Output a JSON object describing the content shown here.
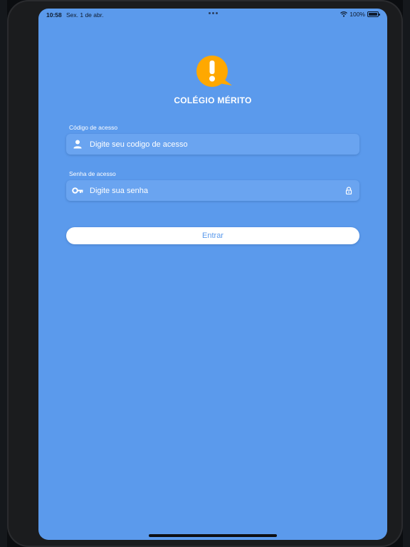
{
  "status_bar": {
    "time": "10:58",
    "date": "Sex. 1 de abr.",
    "battery_level": "100%"
  },
  "brand": {
    "name": "COLÉGIO MÉRITO",
    "logo_color": "#ffa800",
    "logo_icon": "exclamation-bubble-icon"
  },
  "form": {
    "access_code": {
      "label": "Código de acesso",
      "placeholder": "Digite seu codigo de acesso",
      "value": "",
      "icon": "person-icon"
    },
    "password": {
      "label": "Senha de acesso",
      "placeholder": "Digite sua senha",
      "value": "",
      "icon": "key-icon",
      "trailing_icon": "lock-icon"
    },
    "submit_label": "Entrar"
  },
  "colors": {
    "background": "#5b9aec",
    "field": "#6aa4f0",
    "button": "#ffffff",
    "button_text": "#5b9aec"
  }
}
